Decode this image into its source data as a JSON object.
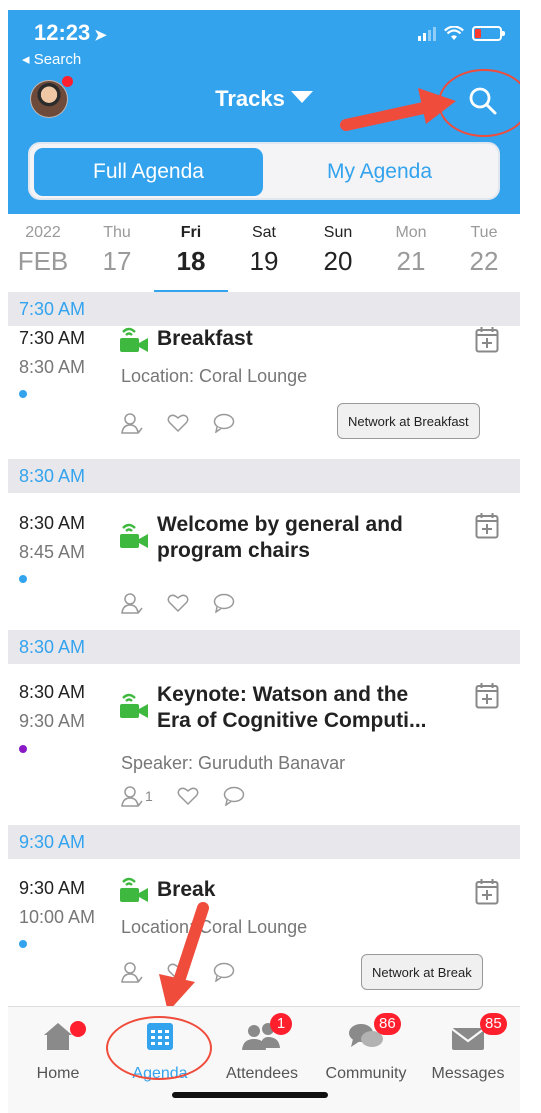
{
  "status_bar": {
    "time": "12:23",
    "back_label": "◂ Search"
  },
  "header": {
    "title": "Tracks"
  },
  "segments": {
    "full": "Full Agenda",
    "mine": "My Agenda",
    "active": "Full Agenda"
  },
  "dates": {
    "year": "2022",
    "month": "FEB",
    "days": [
      {
        "dow": "Thu",
        "num": "17"
      },
      {
        "dow": "Fri",
        "num": "18"
      },
      {
        "dow": "Sat",
        "num": "19"
      },
      {
        "dow": "Sun",
        "num": "20"
      },
      {
        "dow": "Mon",
        "num": "21"
      },
      {
        "dow": "Tue",
        "num": "22"
      }
    ],
    "selected": "Fri 18"
  },
  "agenda": [
    {
      "section": "7:30 AM",
      "start": "7:30 AM",
      "end": "8:30 AM",
      "title": "Breakfast",
      "meta": "Location: Coral Lounge",
      "button": "Network at Breakfast",
      "dot_color": "#33a3ee"
    },
    {
      "section": "8:30 AM",
      "start": "8:30 AM",
      "end": "8:45 AM",
      "title_line1": "Welcome by general and",
      "title_line2": "program chairs",
      "dot_color": "#33a3ee"
    },
    {
      "section": "8:30 AM",
      "start": "8:30 AM",
      "end": "9:30 AM",
      "title_line1": "Keynote: Watson and the",
      "title_line2": "Era of Cognitive Computi...",
      "meta": "Speaker: Guruduth Banavar",
      "attendee_count": "1",
      "dot_color": "#8a1ac6"
    },
    {
      "section": "9:30 AM",
      "start": "9:30 AM",
      "end": "10:00 AM",
      "title": "Break",
      "meta": "Location: Coral Lounge",
      "button": "Network at Break",
      "dot_color": "#33a3ee"
    }
  ],
  "tabbar": {
    "home": "Home",
    "agenda": "Agenda",
    "attendees": "Attendees",
    "attendees_badge": "1",
    "community": "Community",
    "community_badge": "86",
    "messages": "Messages",
    "messages_badge": "85"
  },
  "colors": {
    "accent": "#33a3ee",
    "badge": "#ff1f2d",
    "video_icon": "#3fb83f",
    "annotation": "#ef4c3c"
  },
  "icons": [
    "location-arrow-icon",
    "signal-icon",
    "wifi-icon",
    "battery-icon",
    "chevron-down-icon",
    "search-icon",
    "video-icon",
    "calendar-add-icon",
    "attendee-icon",
    "heart-icon",
    "comment-icon",
    "home-icon",
    "calendar-icon",
    "people-icon",
    "chat-icon",
    "mail-icon"
  ]
}
